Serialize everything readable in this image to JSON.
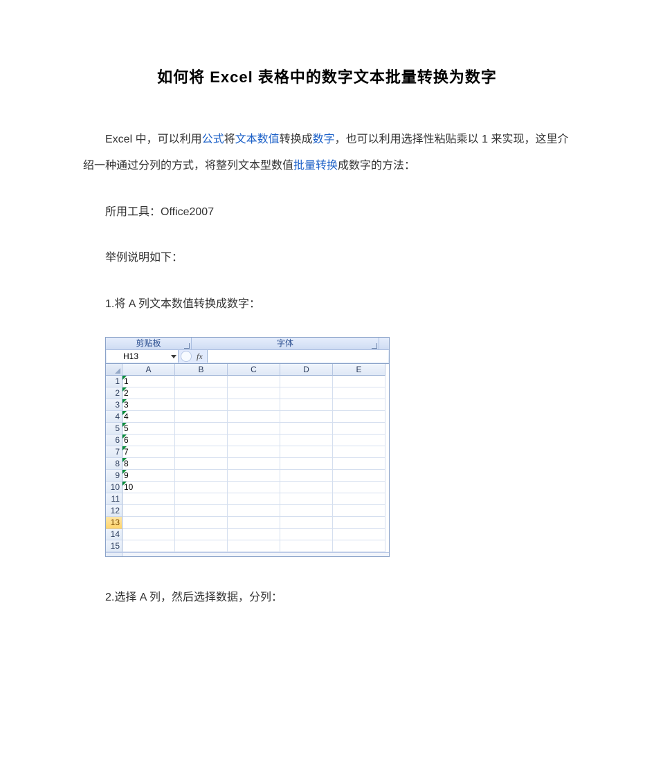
{
  "title": "如何将 Excel 表格中的数字文本批量转换为数字",
  "para1": {
    "t1": "Excel 中，可以利用",
    "link1": "公式",
    "t2": "将",
    "link2": "文本数值",
    "t3": "转换成",
    "link3": "数字",
    "t4": "，也可以利用选择性粘贴乘以 1 来实现，这里介绍一种通过分列的方式，将整列文本型数值",
    "link4": "批量转换",
    "t5": "成数字的方法："
  },
  "tools": "所用工具：Office2007",
  "example": "举例说明如下：",
  "step1": "1.将 A 列文本数值转换成数字：",
  "step2": "2.选择 A 列，然后选择数据，分列：",
  "excel": {
    "ribbon_left": "剪贴板",
    "ribbon_right": "字体",
    "name_box": "H13",
    "fx": "fx",
    "columns": [
      "A",
      "B",
      "C",
      "D",
      "E"
    ],
    "row_count": 15,
    "active_row": 13,
    "col_a_text_values": [
      "1",
      "2",
      "3",
      "4",
      "5",
      "6",
      "7",
      "8",
      "9",
      "10"
    ]
  }
}
